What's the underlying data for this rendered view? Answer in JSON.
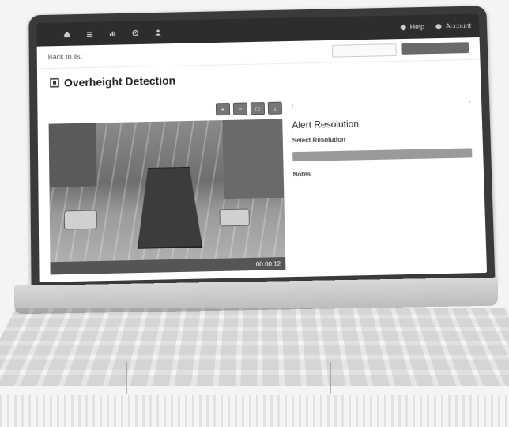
{
  "nav": {
    "brand": "",
    "items": [
      {
        "label": "",
        "icon": "home-icon"
      },
      {
        "label": "",
        "icon": "list-icon"
      },
      {
        "label": "",
        "icon": "chart-icon"
      },
      {
        "label": "",
        "icon": "gear-icon"
      },
      {
        "label": "",
        "icon": "user-icon"
      }
    ],
    "help": "Help",
    "account": "Account"
  },
  "subbar": {
    "back_link": "Back to list",
    "secondary_button": "",
    "primary_button": ""
  },
  "page": {
    "title": "Overheight Detection",
    "subtitle": ""
  },
  "video": {
    "status_label": "00:00:12",
    "toolbar_icons": [
      "zoom-in-icon",
      "zoom-out-icon",
      "fullscreen-icon",
      "download-icon"
    ]
  },
  "panel": {
    "prev_symbol": "‹",
    "next_symbol": "›",
    "title": "Alert Resolution",
    "select_label": "Select Resolution",
    "options": [
      "",
      "",
      "",
      ""
    ],
    "notes_label": "Notes",
    "notes_placeholder": ""
  },
  "colors": {
    "nav_bg": "#2d2d2d",
    "primary_button": "#6a6a6a",
    "resolve_button": "#9a9a9a"
  }
}
